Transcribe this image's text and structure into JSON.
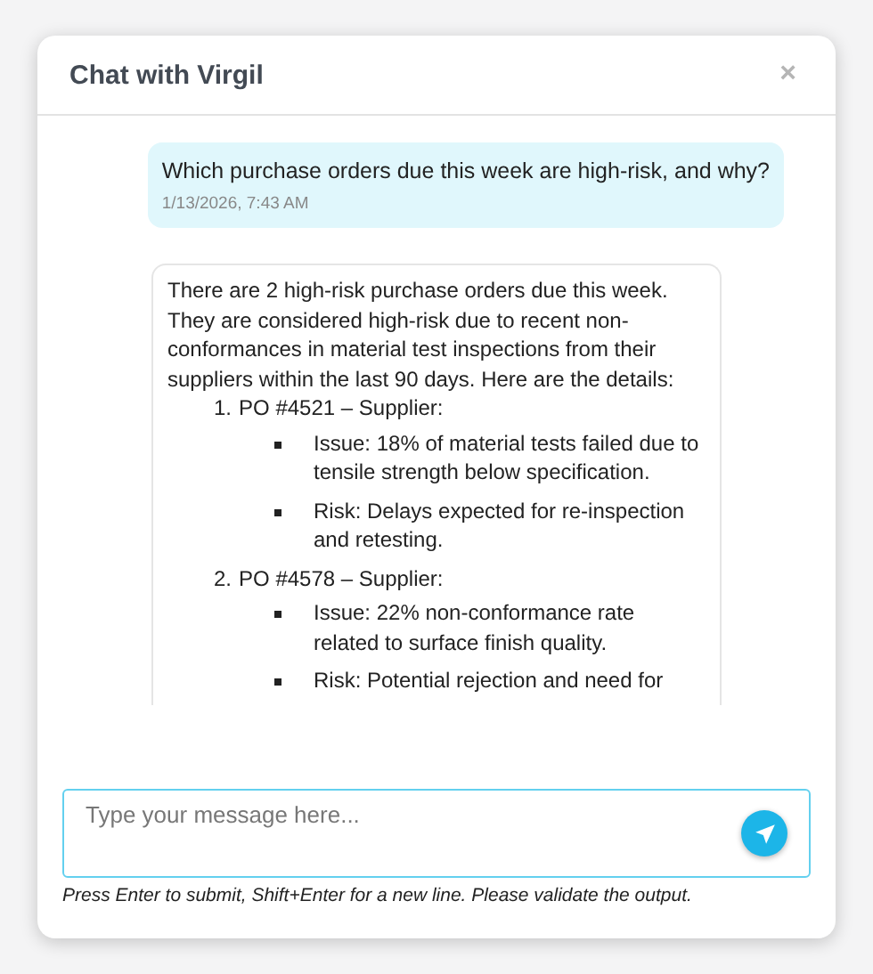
{
  "dialog": {
    "title": "Chat with Virgil",
    "close": "×"
  },
  "messages": [
    {
      "kind": "user",
      "text": "Which purchase orders due this week are high-risk, and why?",
      "time": "1/13/2026, 7:43 AM"
    },
    {
      "kind": "assistant",
      "intro": "There are 2 high-risk purchase orders due this week. They are considered high-risk due to recent non-conformances in material test inspections from their suppliers within the last 90 days. Here are the details:",
      "items": [
        {
          "number": "1.",
          "title": "PO #4521 – Supplier:",
          "bullets": [
            "Issue: 18% of material tests failed due to tensile strength below specification.",
            "Risk: Delays expected for re-inspection and retesting."
          ]
        },
        {
          "number": "2.",
          "title": "PO #4578 – Supplier:",
          "bullets": [
            "Issue: 22% non-conformance rate related to surface finish quality.",
            "Risk: Potential rejection and need for"
          ]
        }
      ]
    }
  ],
  "composer": {
    "placeholder": "Type your message here...",
    "hint": "Press Enter to submit, Shift+Enter for a new line. Please validate the output."
  }
}
